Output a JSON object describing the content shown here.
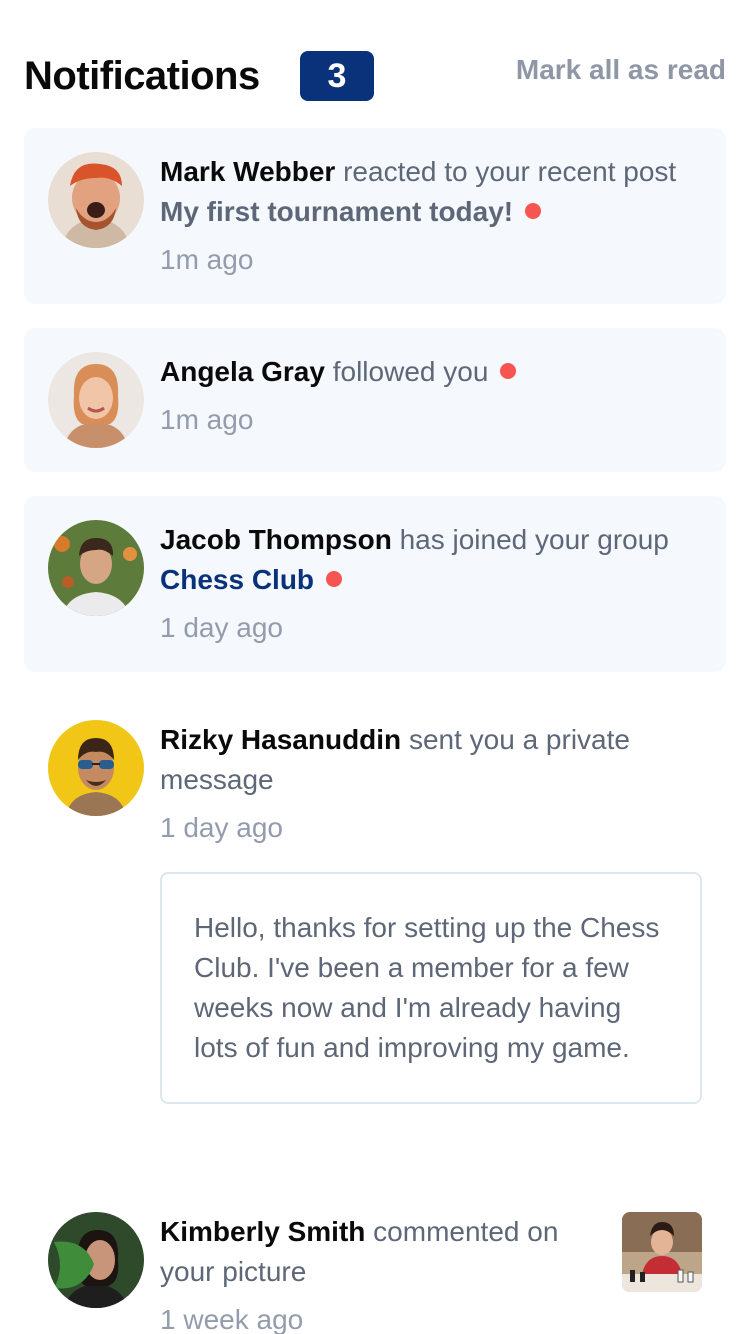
{
  "header": {
    "title": "Notifications",
    "unread_count": "3",
    "mark_all_label": "Mark all as read"
  },
  "notifications": [
    {
      "name": "Mark Webber",
      "action": "reacted to your recent post",
      "target": "My first tournament today!",
      "time": "1m ago",
      "unread": true
    },
    {
      "name": "Angela Gray",
      "action": "followed you",
      "time": "1m ago",
      "unread": true
    },
    {
      "name": "Jacob Thompson",
      "action": "has joined your group",
      "target": "Chess Club",
      "time": "1 day ago",
      "unread": true
    },
    {
      "name": "Rizky Hasanuddin",
      "action": "sent you a private message",
      "time": "1 day ago",
      "unread": false,
      "message": "Hello, thanks for setting up the Chess Club. I've been a member for a few weeks now and I'm already having lots of fun and improving my game."
    },
    {
      "name": "Kimberly Smith",
      "action": "commented on your picture",
      "time": "1 week ago",
      "unread": false
    }
  ],
  "colors": {
    "accent": "#0a327b",
    "unread_dot": "#f65552",
    "unread_bg": "#f5f8fd",
    "muted": "#939cad"
  },
  "icons": [
    "avatar-mark-webber",
    "avatar-angela-gray",
    "avatar-jacob-thompson",
    "avatar-rizky-hasanuddin",
    "avatar-kimberly-smith",
    "chess-picture-thumbnail"
  ]
}
